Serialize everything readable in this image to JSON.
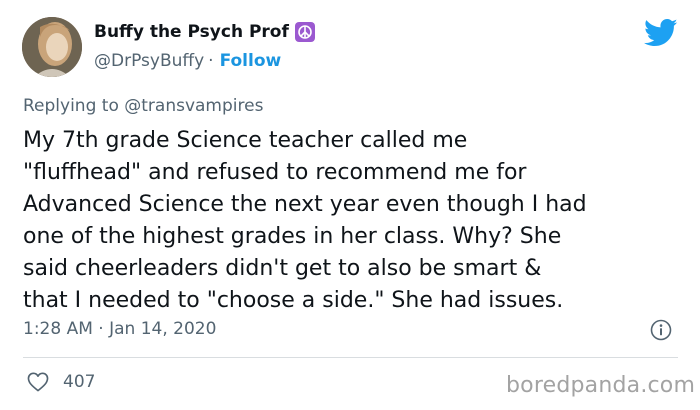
{
  "author": {
    "display_name": "Buffy the Psych Prof",
    "handle": "@DrPsyBuffy",
    "separator": "·",
    "follow_label": "Follow"
  },
  "reply": {
    "prefix": "Replying to",
    "mention": "@transvampires"
  },
  "tweet": {
    "lines": [
      "My 7th grade Science teacher called me",
      "\"fluffhead\" and refused to recommend me for",
      "Advanced Science the next year even though I had",
      "one of the highest grades in her class. Why? She",
      "said cheerleaders didn't get to also be smart &",
      "that I needed to \"choose a side.\" She had issues."
    ],
    "timestamp": "1:28 AM · Jan 14, 2020"
  },
  "engagement": {
    "like_count": "407"
  },
  "watermark": "boredpanda.com",
  "icons": {
    "name_badge": "peace-symbol-icon",
    "brand": "twitter-bird-icon",
    "info": "info-icon",
    "like": "heart-icon"
  },
  "colors": {
    "twitter_blue": "#1da1f2",
    "follow_blue": "#1b95e0",
    "badge_purple": "#9b59d0",
    "secondary_text": "#536471"
  }
}
